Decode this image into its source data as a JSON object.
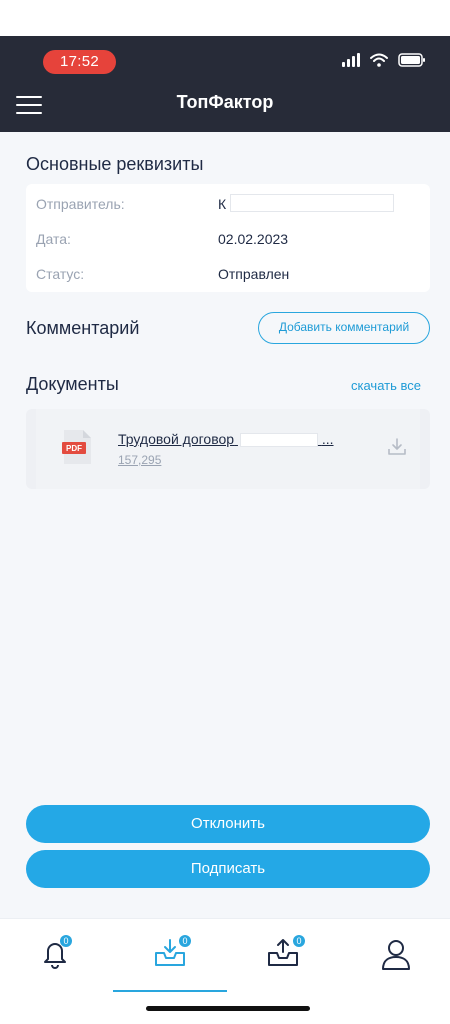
{
  "status_bar": {
    "time": "17:52"
  },
  "header": {
    "title": "ТопФактор"
  },
  "requisites": {
    "title": "Основные реквизиты",
    "rows": [
      {
        "label": "Отправитель:",
        "value": "К"
      },
      {
        "label": "Дата:",
        "value": "02.02.2023"
      },
      {
        "label": "Статус:",
        "value": "Отправлен"
      }
    ]
  },
  "comment": {
    "title": "Комментарий",
    "add_button": "Добавить комментарий"
  },
  "documents": {
    "title": "Документы",
    "download_all": "скачать все",
    "items": [
      {
        "type": "PDF",
        "name": "Трудовой договор",
        "size": "157,295"
      }
    ]
  },
  "actions": {
    "reject": "Отклонить",
    "sign": "Подписать"
  },
  "tabbar": {
    "tabs": [
      {
        "icon": "bell-icon",
        "badge": "0"
      },
      {
        "icon": "inbox-download-icon",
        "badge": "0",
        "active": true
      },
      {
        "icon": "outbox-upload-icon",
        "badge": "0"
      },
      {
        "icon": "user-icon"
      }
    ]
  },
  "colors": {
    "header": "#272b38",
    "accent": "#24a8e6",
    "time_pill": "#e6433b"
  }
}
